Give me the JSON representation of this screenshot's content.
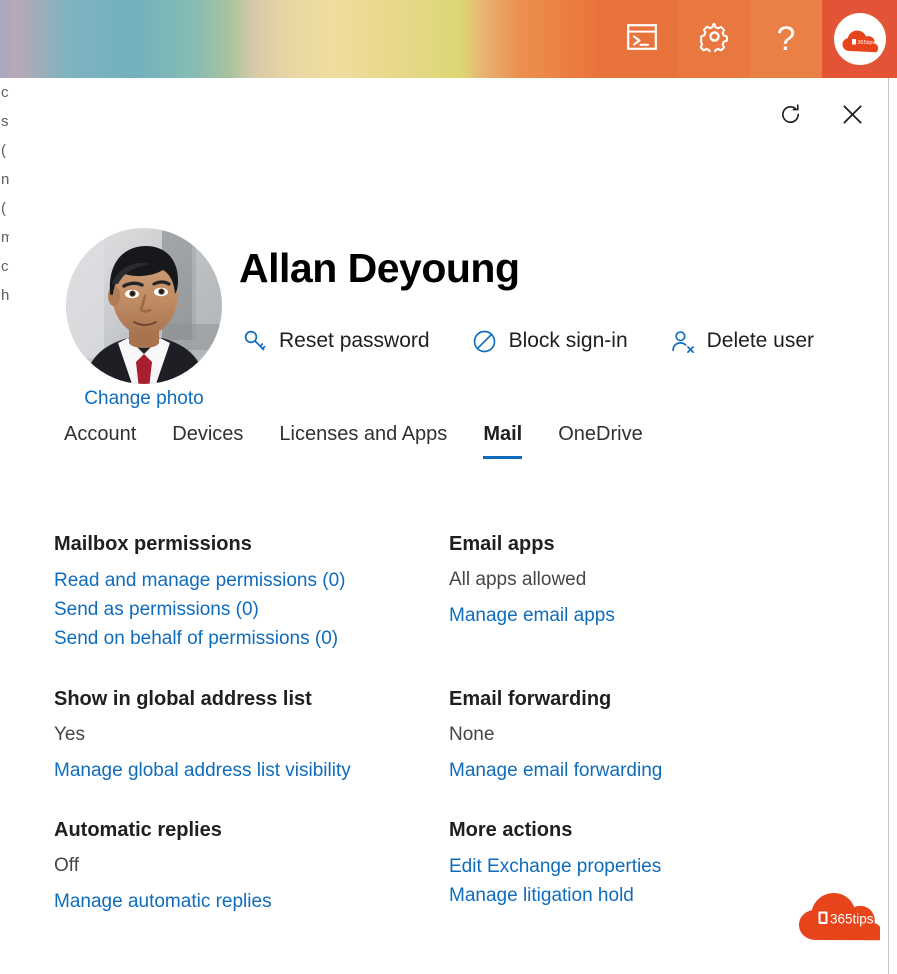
{
  "suite_bar": {
    "buttons": [
      {
        "name": "cloud-shell-icon",
        "label": "Cloud Shell"
      },
      {
        "name": "gear-icon",
        "label": "Settings"
      },
      {
        "name": "help-icon",
        "label": "Help"
      }
    ],
    "avatar_label": "365tips",
    "colors": {
      "action_bg": "#e9733d",
      "avatar_bg": "#e35336",
      "accent_orange": "#e8542e"
    }
  },
  "background_page": {
    "edge_fragments": [
      "c",
      "s",
      "(",
      "n",
      "(",
      "m",
      "c",
      "h"
    ]
  },
  "panel": {
    "commands": [
      {
        "name": "refresh-icon",
        "label": "Refresh"
      },
      {
        "name": "close-icon",
        "label": "Close"
      }
    ],
    "user": {
      "name": "Allan Deyoung",
      "change_photo_label": "Change photo"
    },
    "actions": [
      {
        "icon": "key-icon",
        "label": "Reset password"
      },
      {
        "icon": "block-icon",
        "label": "Block sign-in"
      },
      {
        "icon": "person-delete-icon",
        "label": "Delete user"
      }
    ],
    "tabs": [
      {
        "label": "Account",
        "active": false
      },
      {
        "label": "Devices",
        "active": false
      },
      {
        "label": "Licenses and Apps",
        "active": false
      },
      {
        "label": "Mail",
        "active": true
      },
      {
        "label": "OneDrive",
        "active": false
      }
    ],
    "accent_color": "#0f6cbd",
    "sections": {
      "mailbox_permissions": {
        "title": "Mailbox permissions",
        "links": [
          "Read and manage permissions (0)",
          "Send as permissions (0)",
          "Send on behalf of permissions (0)"
        ]
      },
      "email_apps": {
        "title": "Email apps",
        "value": "All apps allowed",
        "link": "Manage email apps"
      },
      "global_address_list": {
        "title": "Show in global address list",
        "value": "Yes",
        "link": "Manage global address list visibility"
      },
      "email_forwarding": {
        "title": "Email forwarding",
        "value": "None",
        "link": "Manage email forwarding"
      },
      "automatic_replies": {
        "title": "Automatic replies",
        "value": "Off",
        "link": "Manage automatic replies"
      },
      "more_actions": {
        "title": "More actions",
        "links": [
          "Edit Exchange properties",
          "Manage litigation hold"
        ]
      }
    }
  },
  "watermark": {
    "text": "365tips",
    "color": "#e8441b"
  }
}
